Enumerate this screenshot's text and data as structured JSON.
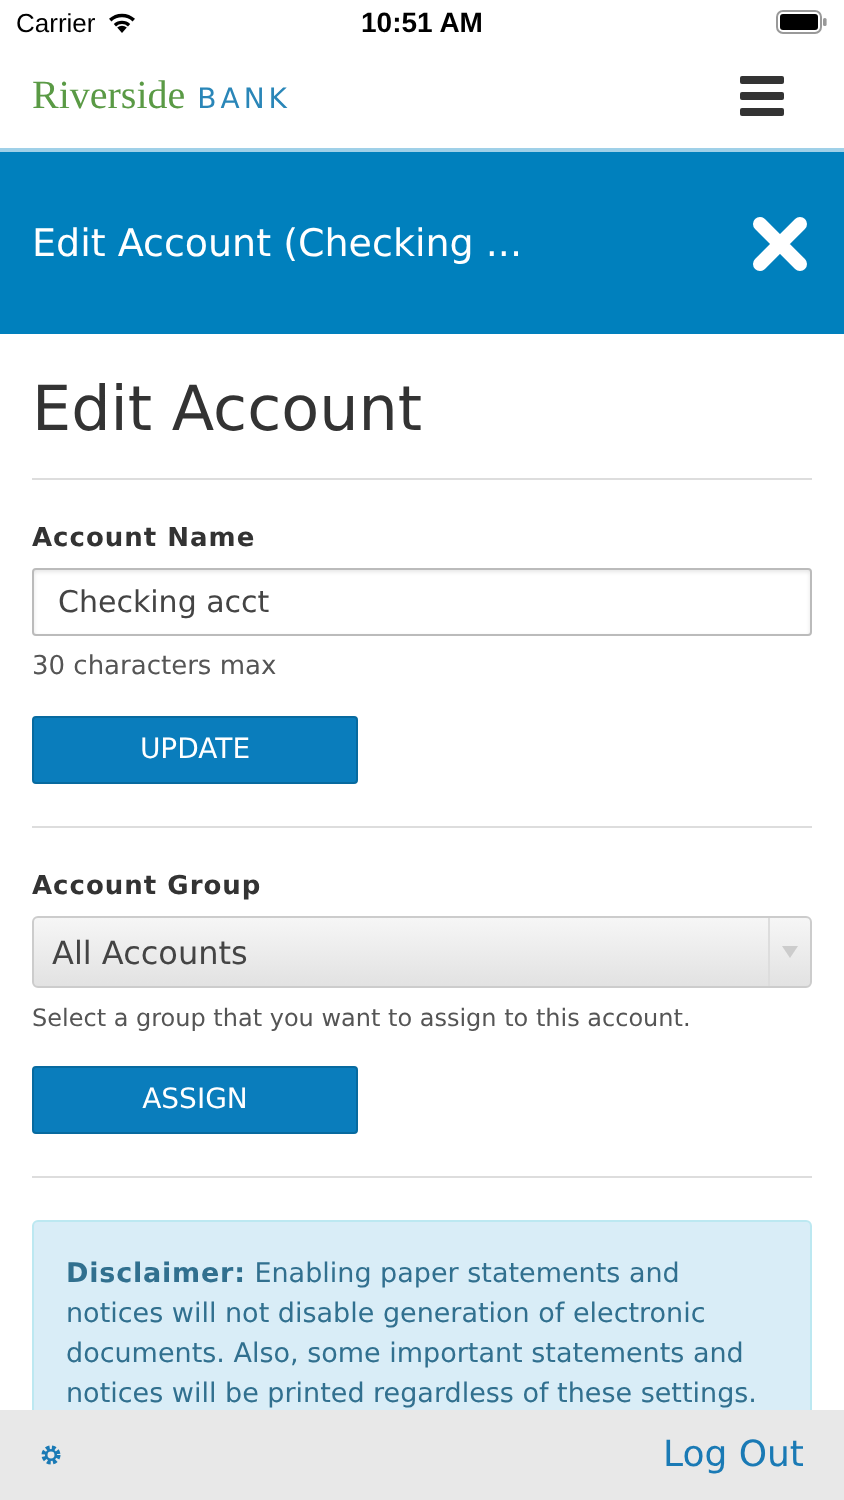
{
  "status_bar": {
    "carrier": "Carrier",
    "time": "10:51 AM"
  },
  "header": {
    "logo_primary": "Riverside",
    "logo_secondary": "BANK"
  },
  "title_bar": {
    "title": "Edit Account (Checking ..."
  },
  "page_title": "Edit Account",
  "account_name": {
    "label": "Account Name",
    "value": "Checking acct",
    "hint": "30 characters max",
    "button": "UPDATE"
  },
  "account_group": {
    "label": "Account Group",
    "value": "All Accounts",
    "hint": "Select a group that you want to assign to this account.",
    "button": "ASSIGN"
  },
  "disclaimer": {
    "label": "Disclaimer:",
    "text": "Enabling paper statements and notices will not disable generation of electronic documents. Also, some important statements and notices will be printed regardless of these settings."
  },
  "footer": {
    "logout": "Log Out"
  }
}
